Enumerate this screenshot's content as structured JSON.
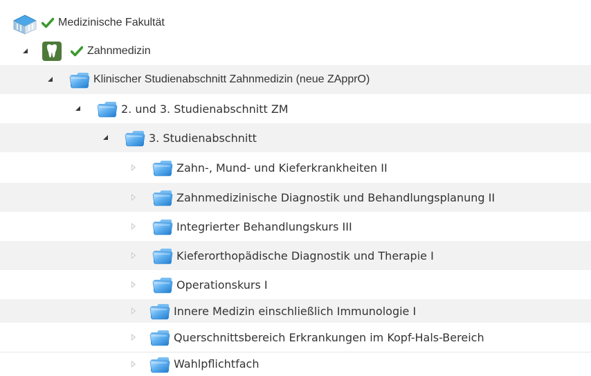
{
  "tree": {
    "root": {
      "label": "Medizinische Fakultät",
      "icon": "faculty-building-icon",
      "status_icon": "check-icon"
    },
    "department": {
      "label": "Zahnmedizin",
      "icon": "tooth-icon",
      "status_icon": "check-icon"
    },
    "nodes": [
      {
        "label": "Klinischer Studienabschnitt Zahnmedizin (neue ZApprO)",
        "expanded": true
      },
      {
        "label": "2. und 3. Studienabschnitt ZM",
        "expanded": true
      },
      {
        "label": "3. Studienabschnitt",
        "expanded": true
      }
    ],
    "leaves": [
      {
        "label": "Zahn-, Mund- und Kieferkrankheiten II",
        "expanded": false
      },
      {
        "label": "Zahnmedizinische Diagnostik und Behandlungsplanung II",
        "expanded": false
      },
      {
        "label": "Integrierter Behandlungskurs III",
        "expanded": false
      },
      {
        "label": "Kieferorthopädische Diagnostik und Therapie I",
        "expanded": false
      },
      {
        "label": "Operationskurs I",
        "expanded": false
      },
      {
        "label": "Innere Medizin einschließlich Immunologie I",
        "expanded": false
      },
      {
        "label": "Querschnittsbereich Erkrankungen im Kopf-Hals-Bereich",
        "expanded": false
      },
      {
        "label": "Wahlpflichtfach",
        "expanded": false
      }
    ],
    "colors": {
      "check": "#3c9a2e",
      "folder": "#4a9be0",
      "tooth_bg": "#4d7a3a",
      "row_alt": "#f2f2f2"
    }
  }
}
